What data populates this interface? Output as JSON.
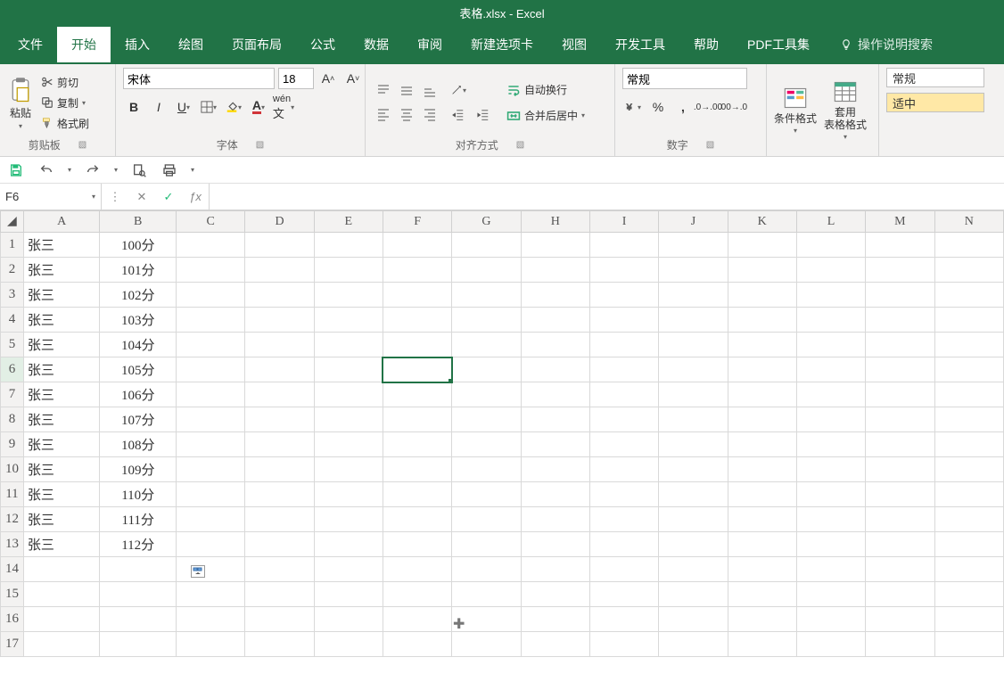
{
  "title": "表格.xlsx - Excel",
  "tabs": [
    "文件",
    "开始",
    "插入",
    "绘图",
    "页面布局",
    "公式",
    "数据",
    "审阅",
    "新建选项卡",
    "视图",
    "开发工具",
    "帮助",
    "PDF工具集"
  ],
  "active_tab_index": 1,
  "search_hint": "操作说明搜索",
  "clipboard": {
    "cut": "剪切",
    "copy": "复制",
    "format_painter": "格式刷",
    "paste": "粘贴",
    "group": "剪贴板"
  },
  "font": {
    "name": "宋体",
    "size": "18",
    "group": "字体"
  },
  "alignment": {
    "wrap": "自动换行",
    "merge": "合并后居中",
    "group": "对齐方式"
  },
  "number": {
    "format": "常规",
    "group": "数字"
  },
  "styles": {
    "cond": "条件格式",
    "table_fmt": "套用\n表格格式",
    "s1": "常规",
    "s2": "适中"
  },
  "name_box": "F6",
  "columns": [
    "A",
    "B",
    "C",
    "D",
    "E",
    "F",
    "G",
    "H",
    "I",
    "J",
    "K",
    "L",
    "M",
    "N"
  ],
  "selected_cell": "F6",
  "rows": [
    {
      "n": "1",
      "A": "张三",
      "B": "100分"
    },
    {
      "n": "2",
      "A": "张三",
      "B": "101分"
    },
    {
      "n": "3",
      "A": "张三",
      "B": "102分"
    },
    {
      "n": "4",
      "A": "张三",
      "B": "103分"
    },
    {
      "n": "5",
      "A": "张三",
      "B": "104分"
    },
    {
      "n": "6",
      "A": "张三",
      "B": "105分"
    },
    {
      "n": "7",
      "A": "张三",
      "B": "106分"
    },
    {
      "n": "8",
      "A": "张三",
      "B": "107分"
    },
    {
      "n": "9",
      "A": "张三",
      "B": "108分"
    },
    {
      "n": "10",
      "A": "张三",
      "B": "109分"
    },
    {
      "n": "11",
      "A": "张三",
      "B": "110分"
    },
    {
      "n": "12",
      "A": "张三",
      "B": "111分"
    },
    {
      "n": "13",
      "A": "张三",
      "B": "112分"
    },
    {
      "n": "14",
      "A": "",
      "B": ""
    },
    {
      "n": "15",
      "A": "",
      "B": ""
    },
    {
      "n": "16",
      "A": "",
      "B": ""
    },
    {
      "n": "17",
      "A": "",
      "B": ""
    }
  ]
}
